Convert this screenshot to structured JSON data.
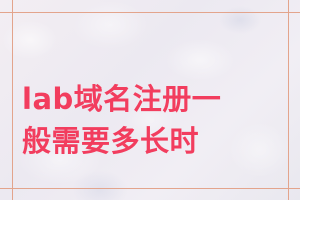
{
  "title": {
    "line1": "lab域名注册一",
    "line2": "般需要多长时"
  },
  "colors": {
    "text": "#f23d5e",
    "frame": "#e3a48c",
    "background": "#eeebf2"
  }
}
